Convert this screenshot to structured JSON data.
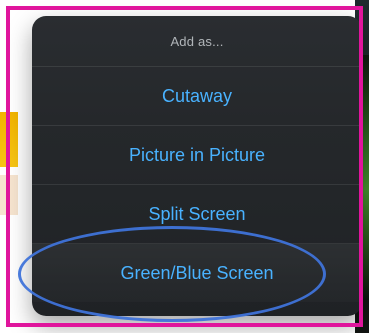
{
  "colors": {
    "accent_text": "#49b2ff",
    "menu_bg": "#25282b",
    "frame_border": "#e0159c",
    "highlight_ellipse": "#3f73d9"
  },
  "menu": {
    "title": "Add as...",
    "items": [
      {
        "label": "Cutaway"
      },
      {
        "label": "Picture in Picture"
      },
      {
        "label": "Split Screen"
      },
      {
        "label": "Green/Blue Screen"
      }
    ]
  }
}
